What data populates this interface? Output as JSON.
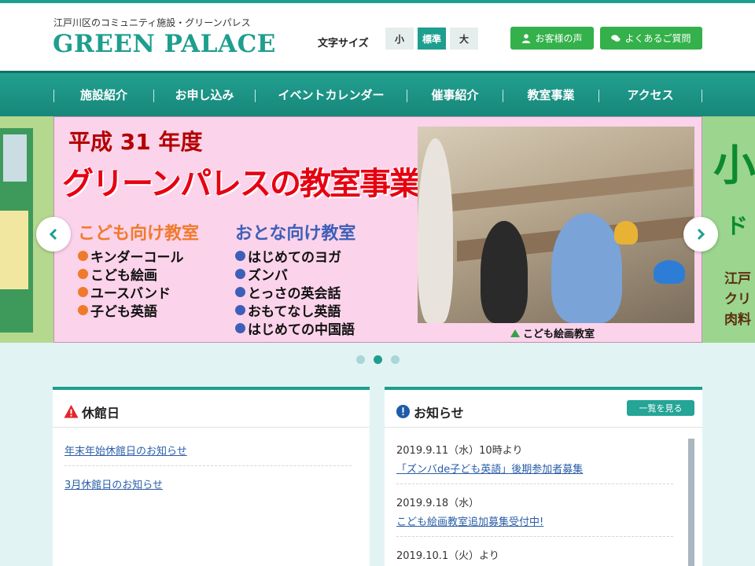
{
  "header": {
    "tagline": "江戸川区のコミュニティ施設・グリーンパレス",
    "logo": "GREEN PALACE",
    "font_size_label": "文字サイズ",
    "font_sizes": [
      "小",
      "標準",
      "大"
    ],
    "active_font_size": "標準",
    "voice_button": "お客様の声",
    "faq_button": "よくあるご質問"
  },
  "nav": {
    "items": [
      "施設紹介",
      "お申し込み",
      "イベントカレンダー",
      "催事紹介",
      "教室事業",
      "アクセス"
    ]
  },
  "slide": {
    "year": "平成 31 年度",
    "title": "グリーンパレスの教室事業",
    "kids_title": "こども向け教室",
    "kids_items": [
      "キンダーコール",
      "こども絵画",
      "ユースバンド",
      "子ども英語"
    ],
    "adult_title": "おとな向け教室",
    "adult_items": [
      "はじめてのヨガ",
      "ズンバ",
      "とっさの英会話",
      "おもてなし英語",
      "はじめての中国語"
    ],
    "caption": "こども絵画教室",
    "right_peek_big": "小",
    "right_peek_lines": [
      "ド",
      "江戸",
      "クリ",
      "肉料"
    ]
  },
  "slider": {
    "dot_count": 3,
    "active_dot": 2
  },
  "closed_panel": {
    "title": "休館日",
    "links": [
      "年末年始休館日のお知らせ",
      "3月休館日のお知らせ"
    ]
  },
  "news_panel": {
    "title": "お知らせ",
    "more_button": "一覧を見る",
    "items": [
      {
        "date": "2019.9.11（水）10時より",
        "text": "「ズンバde子ども英語」後期参加者募集"
      },
      {
        "date": "2019.9.18（水）",
        "text": "こども絵画教室追加募集受付中!"
      },
      {
        "date": "2019.10.1（火）より",
        "text": ""
      }
    ]
  },
  "colors": {
    "brand": "#1e9e8e",
    "green_button": "#34b14a",
    "link": "#2a5ea8",
    "slide_title": "#e60012",
    "kids_accent": "#f07a2c",
    "adult_accent": "#3e5fb8"
  }
}
